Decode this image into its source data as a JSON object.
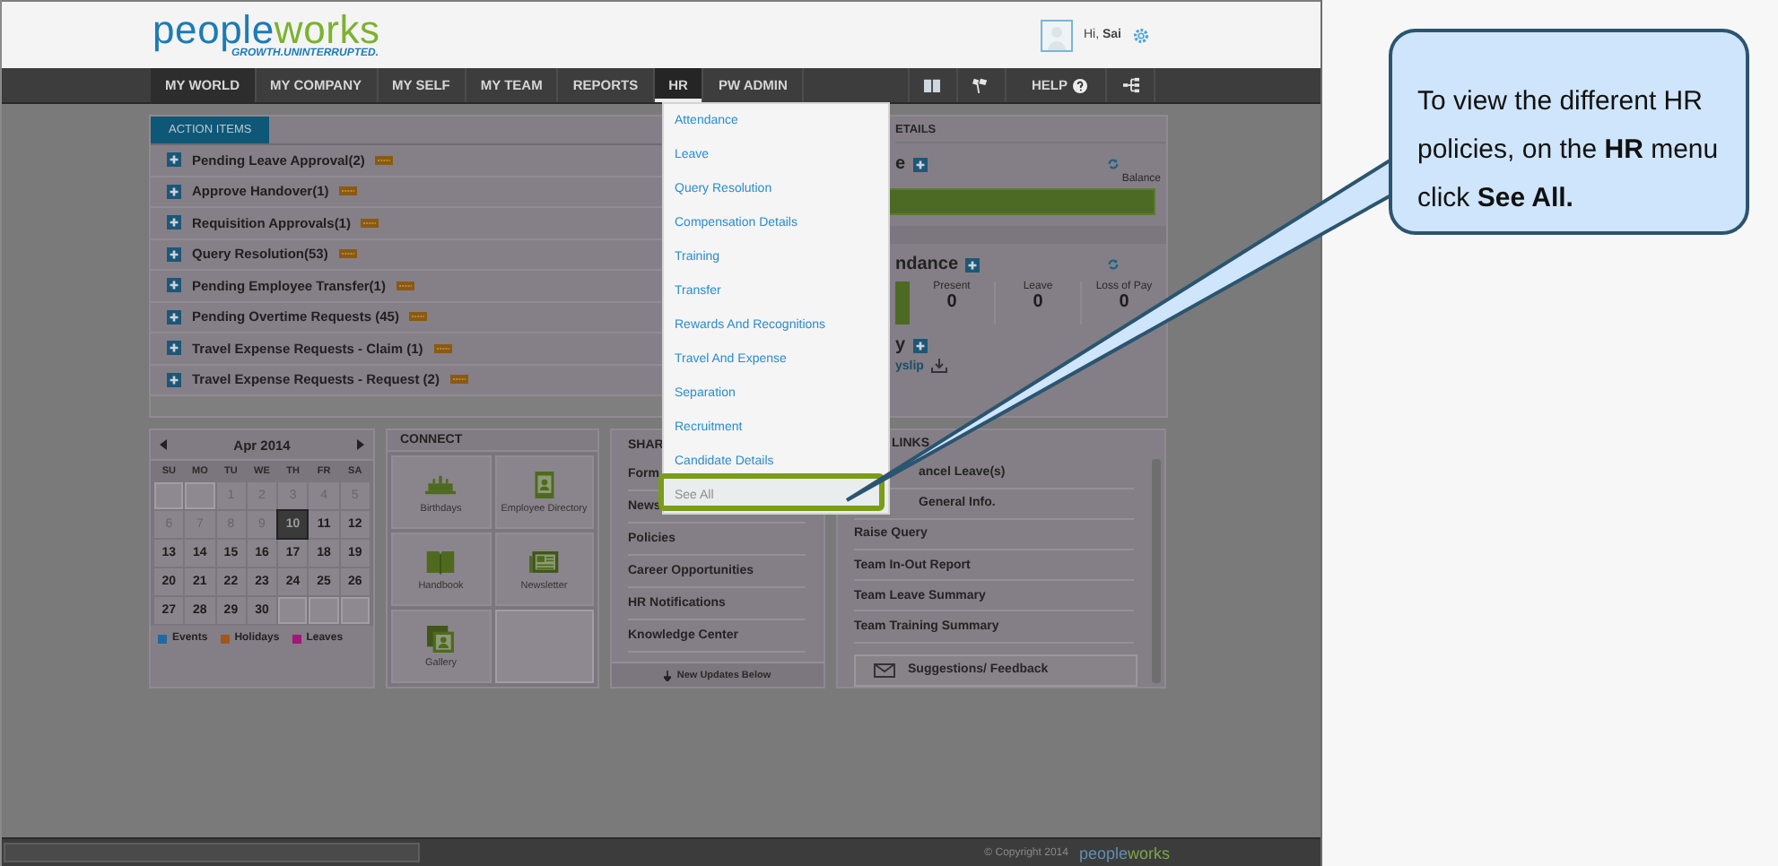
{
  "header": {
    "logo": "peopleworks",
    "tagline": "GROWTH.UNINTERRUPTED.",
    "greeting": "Hi,",
    "user": "Sai"
  },
  "nav": {
    "items": [
      {
        "label": "MY WORLD",
        "selected": false,
        "current": true
      },
      {
        "label": "MY COMPANY",
        "selected": false,
        "current": false
      },
      {
        "label": "MY SELF",
        "selected": false,
        "current": false
      },
      {
        "label": "MY TEAM",
        "selected": false,
        "current": false
      },
      {
        "label": "REPORTS",
        "selected": false,
        "current": false
      },
      {
        "label": "HR",
        "selected": true,
        "current": false
      },
      {
        "label": "PW ADMIN",
        "selected": false,
        "current": false
      }
    ],
    "help": "HELP"
  },
  "action_items": {
    "tab": "ACTION ITEMS",
    "items": [
      {
        "label": "Pending Leave Approval(2)",
        "new": true
      },
      {
        "label": "Approve Handover(1)",
        "new": true
      },
      {
        "label": "Requisition Approvals(1)",
        "new": true
      },
      {
        "label": "Query Resolution(53)",
        "new": true
      },
      {
        "label": "Pending Employee Transfer(1)",
        "new": true
      },
      {
        "label": "Pending Overtime Requests (45)",
        "new": true
      },
      {
        "label": "Travel Expense Requests - Claim (1)",
        "new": true
      },
      {
        "label": "Travel Expense Requests - Request (2)",
        "new": true
      }
    ]
  },
  "details": {
    "title": "ETAILS",
    "leave": {
      "title": "e",
      "balance_label": "Balance"
    },
    "attendance": {
      "title": "ndance",
      "stats": [
        {
          "label": "Present",
          "value": "0"
        },
        {
          "label": "Leave",
          "value": "0"
        },
        {
          "label": "Loss of Pay",
          "value": "0"
        }
      ]
    },
    "salary": {
      "title": "y",
      "link": "yslip"
    }
  },
  "calendar": {
    "month": "Apr 2014",
    "weekdays": [
      "SU",
      "MO",
      "TU",
      "WE",
      "TH",
      "FR",
      "SA"
    ],
    "days": [
      {
        "kind": "blank"
      },
      {
        "kind": "blank"
      },
      {
        "kind": "day",
        "label": "1",
        "muted": true,
        "selected": false
      },
      {
        "kind": "day",
        "label": "2",
        "muted": true,
        "selected": false
      },
      {
        "kind": "day",
        "label": "3",
        "muted": true,
        "selected": false
      },
      {
        "kind": "day",
        "label": "4",
        "muted": true,
        "selected": false
      },
      {
        "kind": "day",
        "label": "5",
        "muted": true,
        "selected": false
      },
      {
        "kind": "day",
        "label": "6",
        "muted": true,
        "selected": false
      },
      {
        "kind": "day",
        "label": "7",
        "muted": true,
        "selected": false
      },
      {
        "kind": "day",
        "label": "8",
        "muted": true,
        "selected": false
      },
      {
        "kind": "day",
        "label": "9",
        "muted": true,
        "selected": false
      },
      {
        "kind": "day",
        "label": "10",
        "muted": false,
        "selected": true
      },
      {
        "kind": "day",
        "label": "11",
        "muted": false,
        "selected": false
      },
      {
        "kind": "day",
        "label": "12",
        "muted": false,
        "selected": false
      },
      {
        "kind": "day",
        "label": "13",
        "muted": false,
        "selected": false
      },
      {
        "kind": "day",
        "label": "14",
        "muted": false,
        "selected": false
      },
      {
        "kind": "day",
        "label": "15",
        "muted": false,
        "selected": false
      },
      {
        "kind": "day",
        "label": "16",
        "muted": false,
        "selected": false
      },
      {
        "kind": "day",
        "label": "17",
        "muted": false,
        "selected": false
      },
      {
        "kind": "day",
        "label": "18",
        "muted": false,
        "selected": false
      },
      {
        "kind": "day",
        "label": "19",
        "muted": false,
        "selected": false
      },
      {
        "kind": "day",
        "label": "20",
        "muted": false,
        "selected": false
      },
      {
        "kind": "day",
        "label": "21",
        "muted": false,
        "selected": false
      },
      {
        "kind": "day",
        "label": "22",
        "muted": false,
        "selected": false
      },
      {
        "kind": "day",
        "label": "23",
        "muted": false,
        "selected": false
      },
      {
        "kind": "day",
        "label": "24",
        "muted": false,
        "selected": false
      },
      {
        "kind": "day",
        "label": "25",
        "muted": false,
        "selected": false
      },
      {
        "kind": "day",
        "label": "26",
        "muted": false,
        "selected": false
      },
      {
        "kind": "day",
        "label": "27",
        "muted": false,
        "selected": false
      },
      {
        "kind": "day",
        "label": "28",
        "muted": false,
        "selected": false
      },
      {
        "kind": "day",
        "label": "29",
        "muted": false,
        "selected": false
      },
      {
        "kind": "day",
        "label": "30",
        "muted": false,
        "selected": false
      },
      {
        "kind": "blank"
      },
      {
        "kind": "blank"
      },
      {
        "kind": "blank"
      }
    ],
    "legend": [
      {
        "label": "Events",
        "color": "#1f6aa0"
      },
      {
        "label": "Holidays",
        "color": "#a3561c"
      },
      {
        "label": "Leaves",
        "color": "#a0187a"
      }
    ]
  },
  "connect": {
    "title": "CONNECT",
    "tiles": [
      {
        "label": "Birthdays",
        "kind": "cake"
      },
      {
        "label": "Employee Directory",
        "kind": "directory"
      },
      {
        "label": "Handbook",
        "kind": "book"
      },
      {
        "label": "Newsletter",
        "kind": "newspaper"
      },
      {
        "label": "Gallery",
        "kind": "gallery"
      }
    ]
  },
  "share": {
    "title": "SHAR",
    "items": [
      "Form",
      "News",
      "Policies",
      "Career Opportunities",
      "HR Notifications",
      "Knowledge Center"
    ],
    "footer": "New Updates Below"
  },
  "quick_links": {
    "title": "LINKS",
    "items": [
      {
        "label": "ancel Leave(s)",
        "obscured": true
      },
      {
        "label": "General Info.",
        "obscured": true
      },
      {
        "label": "Raise Query",
        "obscured": false
      },
      {
        "label": "Team In-Out Report",
        "obscured": false
      },
      {
        "label": "Team Leave Summary",
        "obscured": false
      },
      {
        "label": "Team Training Summary",
        "obscured": false
      }
    ],
    "feedback": "Suggestions/ Feedback"
  },
  "footer": {
    "copyright": "© Copyright 2014",
    "logo": "peopleworks"
  },
  "hr_menu": {
    "items": [
      {
        "label": "Attendance",
        "selected": false
      },
      {
        "label": "Leave",
        "selected": false
      },
      {
        "label": "Query Resolution",
        "selected": false
      },
      {
        "label": "Compensation Details",
        "selected": false
      },
      {
        "label": "Training",
        "selected": false
      },
      {
        "label": "Transfer",
        "selected": false
      },
      {
        "label": "Rewards And Recognitions",
        "selected": false
      },
      {
        "label": "Travel And Expense",
        "selected": false
      },
      {
        "label": "Separation",
        "selected": false
      },
      {
        "label": "Recruitment",
        "selected": false
      },
      {
        "label": "Candidate Details",
        "selected": false
      },
      {
        "label": "See All",
        "selected": true
      }
    ]
  },
  "callout": {
    "text": "To view the different HR policies, on the  **HR** menu click **See All.**"
  }
}
